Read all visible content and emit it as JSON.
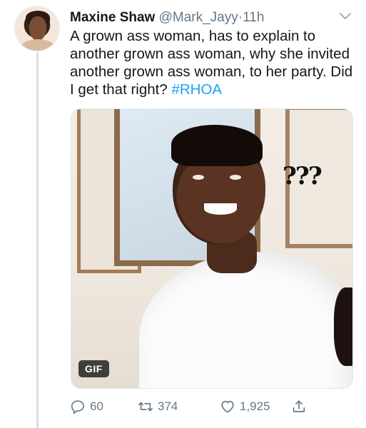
{
  "tweet": {
    "author_name": "Maxine Shaw",
    "handle": "@Mark_Jayy",
    "separator": "·",
    "time": "11h",
    "text": "A grown ass woman, has to explain to another grown ass woman, why she invited another grown ass woman, to her party. Did I get that right?",
    "hashtag": "#RHOA"
  },
  "media": {
    "overlay_text": "???",
    "badge": "GIF"
  },
  "actions": {
    "replies": "60",
    "retweets": "374",
    "likes": "1,925"
  },
  "icons": {
    "menu": "chevron-down-icon",
    "reply": "reply-icon",
    "retweet": "retweet-icon",
    "like": "heart-icon",
    "share": "share-icon"
  },
  "colors": {
    "text": "#14171a",
    "secondary": "#657786",
    "accent": "#1da1f2",
    "thread_line": "#d7e0e7"
  }
}
